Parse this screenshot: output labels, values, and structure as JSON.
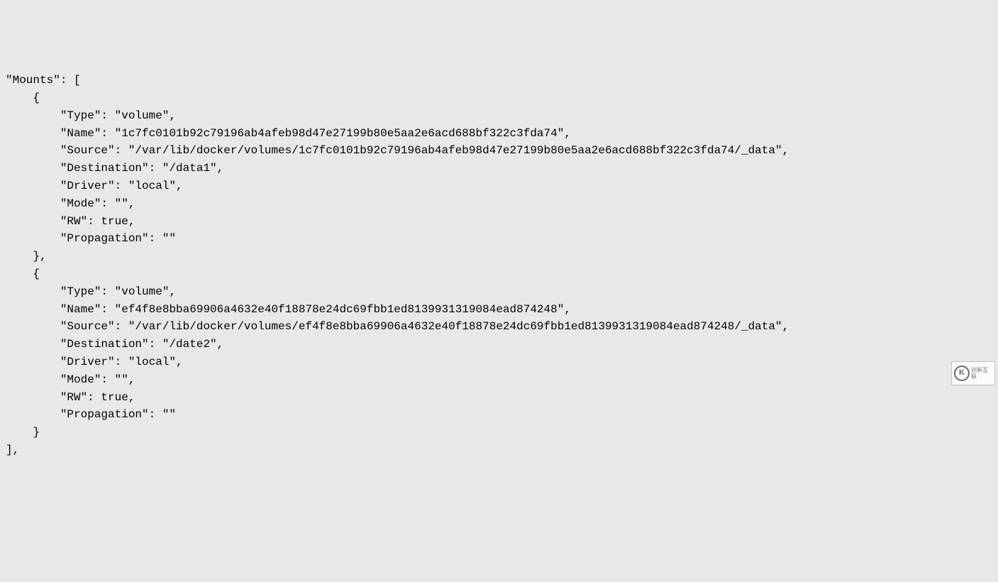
{
  "code": {
    "lines": [
      "\"Mounts\": [",
      "    {",
      "        \"Type\": \"volume\",",
      "        \"Name\": \"1c7fc0101b92c79196ab4afeb98d47e27199b80e5aa2e6acd688bf322c3fda74\",",
      "        \"Source\": \"/var/lib/docker/volumes/1c7fc0101b92c79196ab4afeb98d47e27199b80e5aa2e6acd688bf322c3fda74/_data\",",
      "        \"Destination\": \"/data1\",",
      "        \"Driver\": \"local\",",
      "        \"Mode\": \"\",",
      "        \"RW\": true,",
      "        \"Propagation\": \"\"",
      "    },",
      "    {",
      "        \"Type\": \"volume\",",
      "        \"Name\": \"ef4f8e8bba69906a4632e40f18878e24dc69fbb1ed8139931319084ead874248\",",
      "        \"Source\": \"/var/lib/docker/volumes/ef4f8e8bba69906a4632e40f18878e24dc69fbb1ed8139931319084ead874248/_data\",",
      "        \"Destination\": \"/date2\",",
      "        \"Driver\": \"local\",",
      "        \"Mode\": \"\",",
      "        \"RW\": true,",
      "        \"Propagation\": \"\"",
      "    }",
      "],"
    ]
  },
  "watermark": {
    "logo_letter": "K",
    "text": "创新互联"
  }
}
